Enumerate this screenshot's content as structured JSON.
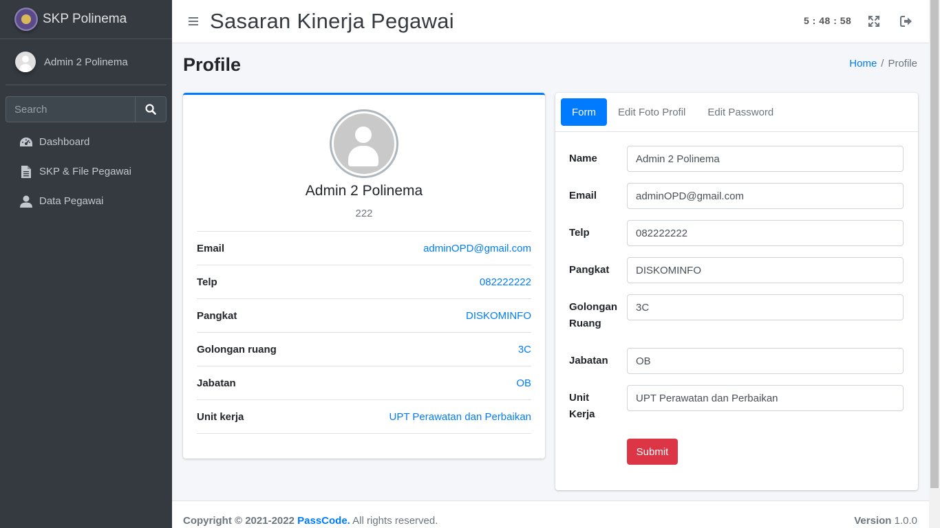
{
  "brand": {
    "name": "SKP Polinema"
  },
  "user_panel": {
    "name": "Admin 2 Polinema"
  },
  "sidebar_search": {
    "placeholder": "Search"
  },
  "nav": [
    {
      "label": "Dashboard",
      "icon": "tachometer-icon"
    },
    {
      "label": "SKP & File Pegawai",
      "icon": "file-icon"
    },
    {
      "label": "Data Pegawai",
      "icon": "user-icon"
    }
  ],
  "header": {
    "title": "Sasaran Kinerja Pegawai",
    "clock": "5 : 48 : 58"
  },
  "page": {
    "title": "Profile"
  },
  "breadcrumb": {
    "home": "Home",
    "sep": "/",
    "current": "Profile"
  },
  "profile": {
    "name": "Admin 2 Polinema",
    "id": "222",
    "rows": [
      {
        "label": "Email",
        "value": "adminOPD@gmail.com"
      },
      {
        "label": "Telp",
        "value": "082222222"
      },
      {
        "label": "Pangkat",
        "value": "DISKOMINFO"
      },
      {
        "label": "Golongan ruang",
        "value": "3C"
      },
      {
        "label": "Jabatan",
        "value": "OB"
      },
      {
        "label": "Unit kerja",
        "value": "UPT Perawatan dan Perbaikan"
      }
    ]
  },
  "tabs": [
    {
      "label": "Form",
      "active": true
    },
    {
      "label": "Edit Foto Profil",
      "active": false
    },
    {
      "label": "Edit Password",
      "active": false
    }
  ],
  "form": {
    "fields": [
      {
        "label": "Name",
        "value": "Admin 2 Polinema"
      },
      {
        "label": "Email",
        "value": "adminOPD@gmail.com"
      },
      {
        "label": "Telp",
        "value": "082222222"
      },
      {
        "label": "Pangkat",
        "value": "DISKOMINFO"
      },
      {
        "label_line1": "Golongan",
        "label_line2": "Ruang",
        "value": "3C"
      },
      {
        "label": "Jabatan",
        "value": "OB"
      },
      {
        "label_line1": "Unit",
        "label_line2": "Kerja",
        "value": "UPT Perawatan dan Perbaikan"
      }
    ],
    "submit_label": "Submit"
  },
  "footer": {
    "copyright": "Copyright © 2021-2022",
    "company": "PassCode.",
    "rights": "All rights reserved.",
    "version_label": "Version",
    "version": "1.0.0"
  },
  "colors": {
    "primary": "#007bff",
    "danger": "#dc3545",
    "sidebar": "#343a40"
  }
}
